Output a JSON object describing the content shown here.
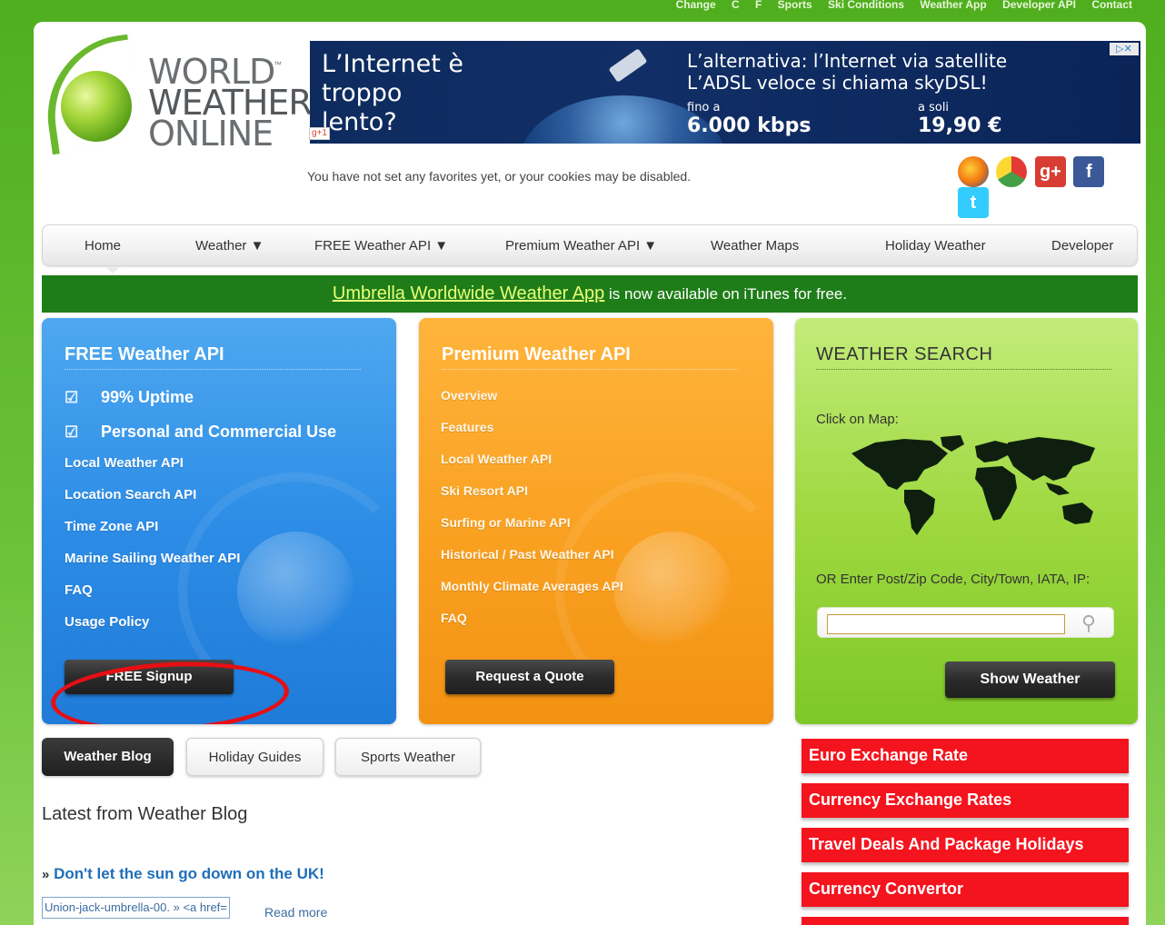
{
  "topbar": {
    "links": [
      "Change",
      "C",
      "F",
      "Sports",
      "Ski Conditions",
      "Weather App",
      "Developer API",
      "Contact"
    ]
  },
  "logo": {
    "line1": "WORLD",
    "line2": "WEATHER",
    "line3": "ONLINE",
    "tm": "™"
  },
  "ad": {
    "left_line1": "L’Internet è",
    "left_line2": "troppo",
    "left_line3": "lento?",
    "right_line1": "L’alternativa: l’Internet via satellite",
    "right_line2": "L’ADSL veloce si chiama skyDSL!",
    "price1_small": "fino a",
    "price1_big": "6.000 kbps",
    "price2_small": "a soli",
    "price2_big": "19,90 €",
    "close_label": "▷✕",
    "gplus": "g+1"
  },
  "header": {
    "favorites_message": "You have not set any favorites yet, or your cookies may be disabled."
  },
  "social": [
    {
      "name": "firefox",
      "glyph": "●",
      "color": "#e66000"
    },
    {
      "name": "chrome",
      "glyph": "●",
      "color": "#2f9e44"
    },
    {
      "name": "google-plus",
      "glyph": "g+",
      "color": "#d73d32"
    },
    {
      "name": "facebook",
      "glyph": "f",
      "color": "#3b5998"
    },
    {
      "name": "twitter",
      "glyph": "t",
      "color": "#33ccff"
    }
  ],
  "nav": {
    "items": [
      {
        "label": "Home"
      },
      {
        "label": "Weather ▼"
      },
      {
        "label": "FREE Weather API ▼"
      },
      {
        "label": "Premium Weather API ▼"
      },
      {
        "label": "Weather Maps"
      },
      {
        "label": "Holiday Weather"
      },
      {
        "label": "Developer"
      }
    ]
  },
  "banner": {
    "link": "Umbrella Worldwide Weather App",
    "text": " is now available on iTunes for free."
  },
  "free_api": {
    "title": "FREE Weather API",
    "checks": [
      "99% Uptime",
      "Personal and Commercial Use"
    ],
    "links": [
      "Local Weather API",
      "Location Search API",
      "Time Zone API",
      "Marine Sailing Weather API",
      "FAQ",
      "Usage Policy"
    ],
    "button": "FREE Signup"
  },
  "premium_api": {
    "title": "Premium Weather API",
    "links": [
      "Overview",
      "Features",
      "Local Weather API",
      "Ski Resort API",
      "Surfing or Marine API",
      "Historical / Past Weather API",
      "Monthly Climate Averages API",
      "FAQ"
    ],
    "button": "Request a Quote"
  },
  "weather_search": {
    "title": "WEATHER SEARCH",
    "map_label": "Click on Map:",
    "or_label": "OR  Enter Post/Zip Code, City/Town, IATA, IP:",
    "input_value": "",
    "button": "Show Weather"
  },
  "tabs": [
    {
      "label": "Weather Blog",
      "active": true
    },
    {
      "label": "Holiday Guides",
      "active": false
    },
    {
      "label": "Sports Weather",
      "active": false
    }
  ],
  "blog": {
    "heading": "Latest from Weather Blog",
    "raquo": "»",
    "post_title": "Don't let the sun go down on the UK!",
    "image_alt": "Union-jack-umbrella-00. » <a href=",
    "read_more": "Read more"
  },
  "red_links": [
    "Euro Exchange Rate",
    "Currency Exchange Rates",
    "Travel Deals And Package Holidays",
    "Currency Convertor"
  ]
}
